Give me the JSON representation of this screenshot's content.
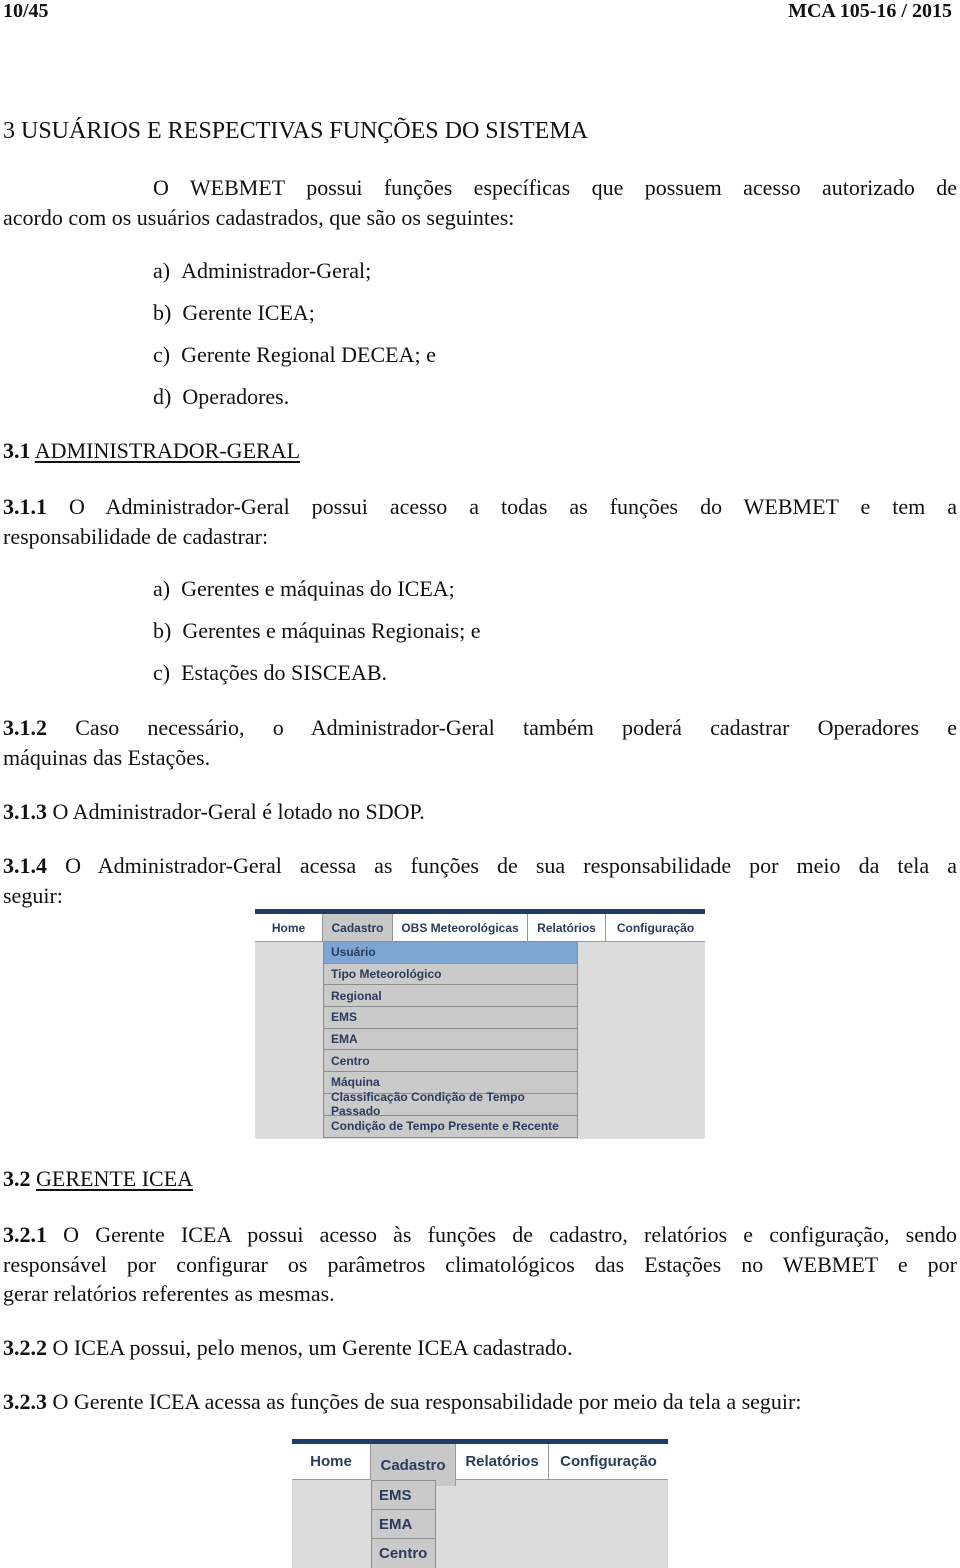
{
  "header": {
    "page_number": "10/45",
    "doc_id": "MCA 105-16 / 2015"
  },
  "chapter": {
    "title": "3 USUÁRIOS E RESPECTIVAS FUNÇÕES DO SISTEMA",
    "intro_line1": "O WEBMET possui funções específicas que possuem acesso autorizado de",
    "intro_line2": "acordo com os usuários cadastrados, que são os seguintes:",
    "users": [
      {
        "marker": "a)",
        "text": "Administrador-Geral;"
      },
      {
        "marker": "b)",
        "text": "Gerente ICEA;"
      },
      {
        "marker": "c)",
        "text": "Gerente Regional DECEA; e"
      },
      {
        "marker": "d)",
        "text": "Operadores."
      }
    ]
  },
  "section_3_1": {
    "number": "3.1",
    "title": "ADMINISTRADOR-GERAL",
    "p1_number": "3.1.1",
    "p1_line1": "O Administrador-Geral possui acesso a todas as funções do WEBMET e tem a",
    "p1_line2": "responsabilidade de cadastrar:",
    "p1_items": [
      {
        "marker": "a)",
        "text": "Gerentes e máquinas do ICEA;"
      },
      {
        "marker": "b)",
        "text": "Gerentes e máquinas Regionais; e"
      },
      {
        "marker": "c)",
        "text": "Estações do SISCEAB."
      }
    ],
    "p2_number": "3.1.2",
    "p2_line1": "Caso necessário, o Administrador-Geral também poderá cadastrar Operadores e",
    "p2_line2": "máquinas das Estações.",
    "p3_number": "3.1.3",
    "p3_text": "O Administrador-Geral é lotado no SDOP.",
    "p4_number": "3.1.4",
    "p4_line1": "O Administrador-Geral acessa as funções de sua responsabilidade por meio da tela a",
    "p4_line2": "seguir:"
  },
  "screenshot_admin": {
    "nav": [
      "Home",
      "Cadastro",
      "OBS Meteorológicas",
      "Relatórios",
      "Configuração"
    ],
    "active_tab": "Cadastro",
    "menu": [
      "Usuário",
      "Tipo Meteorológico",
      "Regional",
      "EMS",
      "EMA",
      "Centro",
      "Máquina",
      "Classificação Condição de Tempo Passado",
      "Condição de Tempo Presente e Recente"
    ],
    "highlighted_item": "Usuário",
    "colors": {
      "topbar": "#1f3c64",
      "highlight": "#7fa6d3",
      "text": "#2a3b5e",
      "menu_bg": "#c8c8c8"
    }
  },
  "section_3_2": {
    "number": "3.2",
    "title": "GERENTE ICEA",
    "p1_number": "3.2.1",
    "p1_line1": "O Gerente ICEA possui acesso às funções de cadastro, relatórios e configuração, sendo",
    "p1_line2": "responsável por configurar os parâmetros climatológicos das Estações no WEBMET e por",
    "p1_line3": "gerar relatórios referentes as mesmas.",
    "p2_number": "3.2.2",
    "p2_text": "O ICEA possui, pelo menos, um Gerente ICEA cadastrado.",
    "p3_number": "3.2.3",
    "p3_text": "O Gerente ICEA acessa as funções de sua responsabilidade por meio da tela a seguir:"
  },
  "screenshot_icea": {
    "nav": [
      "Home",
      "Cadastro",
      "Relatórios",
      "Configuração"
    ],
    "active_tab": "Cadastro",
    "menu": [
      "EMS",
      "EMA",
      "Centro"
    ]
  }
}
